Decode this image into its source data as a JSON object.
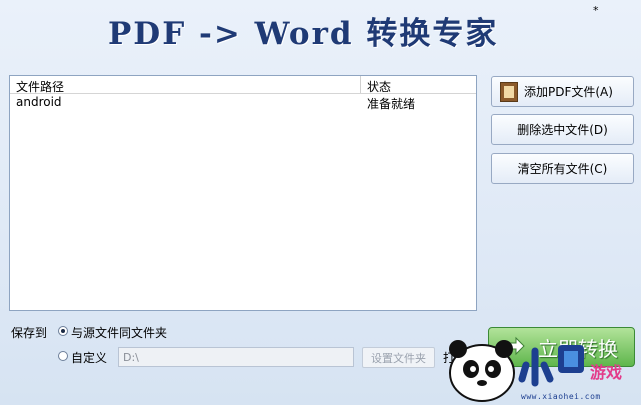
{
  "app": {
    "title": "PDF -> Word 转换专家",
    "corner_mark": "*"
  },
  "file_list": {
    "columns": [
      "文件路径",
      "状态"
    ],
    "rows": [
      {
        "path": "android",
        "status": "准备就绪"
      }
    ]
  },
  "buttons": {
    "add_pdf": "添加PDF文件(A)",
    "delete_selected": "删除选中文件(D)",
    "clear_all": "清空所有文件(C)",
    "convert_now": "立即转换"
  },
  "save_to": {
    "label": "保存到",
    "option_same_folder": "与源文件同文件夹",
    "option_custom": "自定义",
    "custom_dir_value": "D:\\",
    "set_folder_button": "设置文件夹",
    "open_text": "打"
  },
  "watermark": {
    "site": "www.xiaohei.com",
    "brand_text": "小黑游戏"
  },
  "colors": {
    "title": "#1f3a75",
    "convert_button": "#5fb64c",
    "background": "#dfe9f6"
  }
}
